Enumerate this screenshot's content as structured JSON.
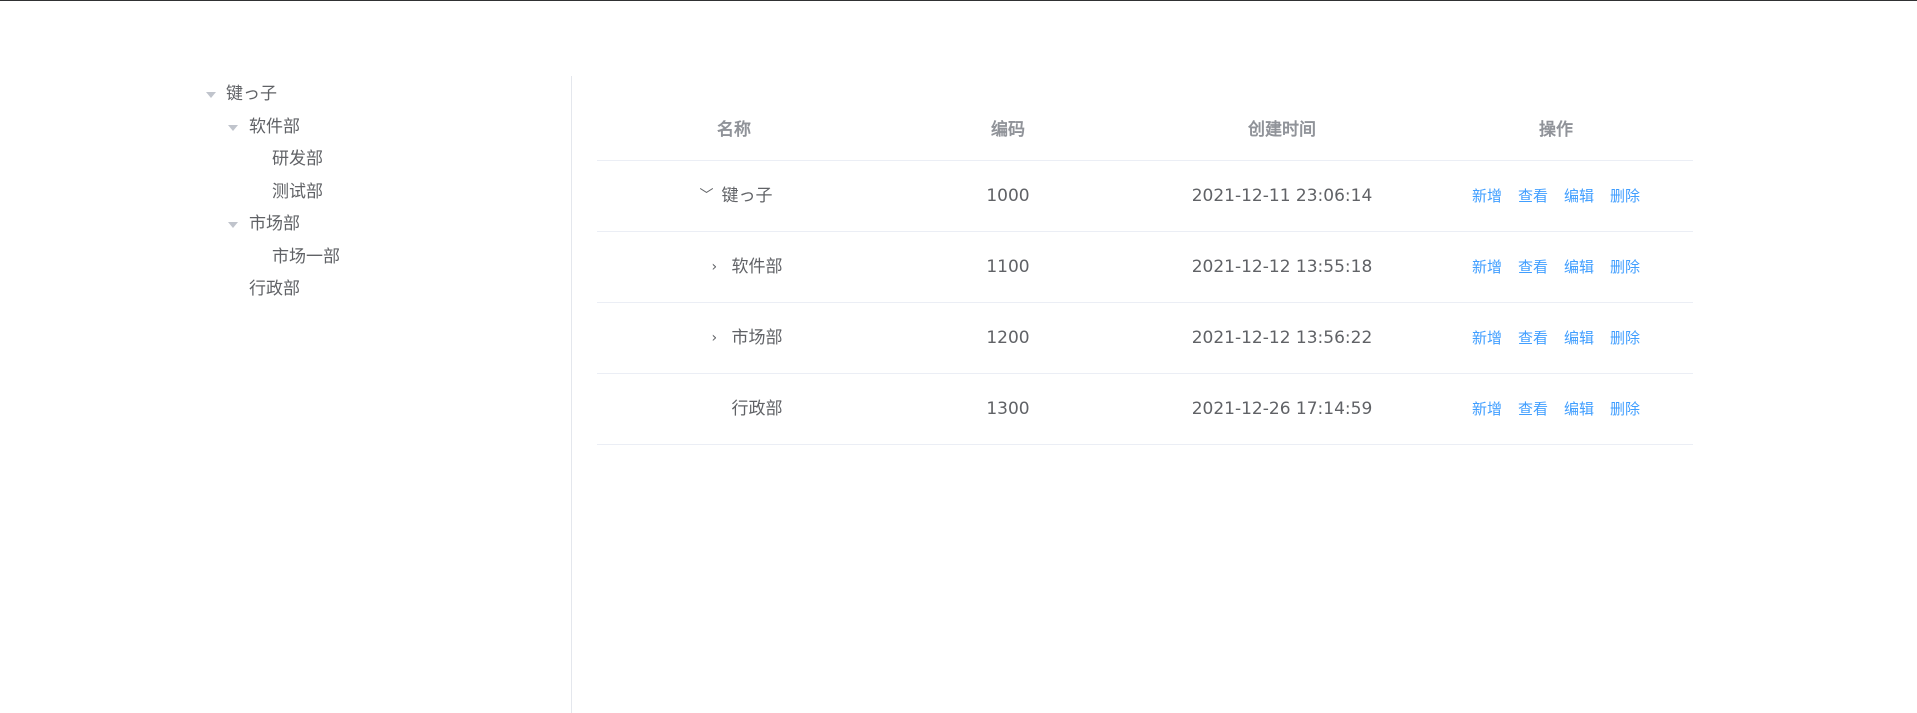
{
  "tree": {
    "nodes": [
      {
        "label": "键っ子",
        "level": 0,
        "expanded": true,
        "has_children": true
      },
      {
        "label": "软件部",
        "level": 1,
        "expanded": true,
        "has_children": true
      },
      {
        "label": "研发部",
        "level": 2,
        "expanded": false,
        "has_children": false
      },
      {
        "label": "测试部",
        "level": 2,
        "expanded": false,
        "has_children": false
      },
      {
        "label": "市场部",
        "level": 1,
        "expanded": true,
        "has_children": true
      },
      {
        "label": "市场一部",
        "level": 2,
        "expanded": false,
        "has_children": false
      },
      {
        "label": "行政部",
        "level": 1,
        "expanded": false,
        "has_children": false
      }
    ]
  },
  "table": {
    "columns": [
      "名称",
      "编码",
      "创建时间",
      "操作"
    ],
    "rows": [
      {
        "name": "键っ子",
        "code": "1000",
        "created": "2021-12-11 23:06:14",
        "expand": "expanded"
      },
      {
        "name": "软件部",
        "code": "1100",
        "created": "2021-12-12 13:55:18",
        "expand": "collapsed"
      },
      {
        "name": "市场部",
        "code": "1200",
        "created": "2021-12-12 13:56:22",
        "expand": "collapsed"
      },
      {
        "name": "行政部",
        "code": "1300",
        "created": "2021-12-26 17:14:59",
        "expand": "none"
      }
    ],
    "actions": {
      "add": "新增",
      "view": "查看",
      "edit": "编辑",
      "delete": "删除"
    }
  },
  "colors": {
    "link": "#409eff",
    "text": "#606266",
    "header": "#909399",
    "border": "#ebeef5"
  }
}
